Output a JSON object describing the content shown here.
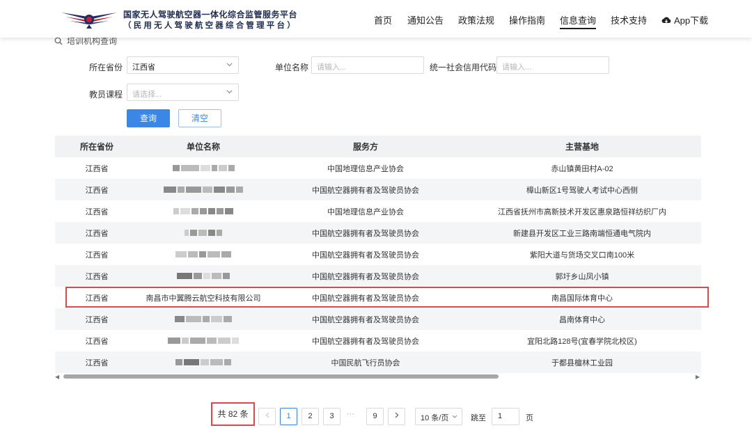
{
  "header": {
    "brand_line1": "国家无人驾驶航空器一体化综合监管服务平台",
    "brand_line2": "（民用无人驾驶航空器综合管理平台）",
    "nav": [
      "首页",
      "通知公告",
      "政策法规",
      "操作指南",
      "信息查询",
      "技术支持"
    ],
    "active_nav": "信息查询",
    "app_download": "App下载"
  },
  "search": {
    "section_title": "培训机构查询",
    "province_label": "所在省份",
    "province_value": "江西省",
    "unit_label": "单位名称",
    "unit_placeholder": "请输入...",
    "credit_label": "统一社会信用代码",
    "credit_placeholder": "请输入...",
    "course_label": "教员课程",
    "course_placeholder": "请选择...",
    "query_button": "查询",
    "clear_button": "清空"
  },
  "table": {
    "columns": [
      "所在省份",
      "单位名称",
      "服务方",
      "主营基地"
    ],
    "rows": [
      {
        "province": "江西省",
        "name": "",
        "service": "中国地理信息产业协会",
        "base": "赤山镇黄田村A-02"
      },
      {
        "province": "江西省",
        "name": "",
        "service": "中国航空器拥有者及驾驶员协会",
        "base": "樟山新区1号驾驶人考试中心西侧"
      },
      {
        "province": "江西省",
        "name": "",
        "service": "中国地理信息产业协会",
        "base": "江西省抚州市高新技术开发区惠泉路恒祥纺织厂内"
      },
      {
        "province": "江西省",
        "name": "",
        "service": "中国航空器拥有者及驾驶员协会",
        "base": "新建县开发区工业三路南端恒通电气院内"
      },
      {
        "province": "江西省",
        "name": "",
        "service": "中国航空器拥有者及驾驶员协会",
        "base": "紫阳大道与货场交叉口南100米"
      },
      {
        "province": "江西省",
        "name": "",
        "service": "中国航空器拥有者及驾驶员协会",
        "base": "郭圩乡山凤小镇"
      },
      {
        "province": "江西省",
        "name": "南昌市中翼腾云航空科技有限公司",
        "service": "中国航空器拥有者及驾驶员协会",
        "base": "南昌国际体育中心"
      },
      {
        "province": "江西省",
        "name": "",
        "service": "中国航空器拥有者及驾驶员协会",
        "base": "昌南体育中心"
      },
      {
        "province": "江西省",
        "name": "",
        "service": "中国航空器拥有者及驾驶员协会",
        "base": "宜阳北路128号(宜春学院北校区)"
      },
      {
        "province": "江西省",
        "name": "",
        "service": "中国民航飞行员协会",
        "base": "于都县檀林工业园"
      }
    ],
    "highlight_row_index": 6
  },
  "pagination": {
    "total": "共 82 条",
    "pages": [
      "1",
      "2",
      "3",
      "9"
    ],
    "ellipsis": "···",
    "current": "1",
    "page_size": "10 条/页",
    "jump_label": "跳至",
    "jump_value": "1",
    "page_unit": "页"
  },
  "colors": {
    "accent": "#3a87e6",
    "highlight_border": "#e0464a",
    "row_alt": "#f4f5f7",
    "header_bg": "#f0f2f4"
  }
}
